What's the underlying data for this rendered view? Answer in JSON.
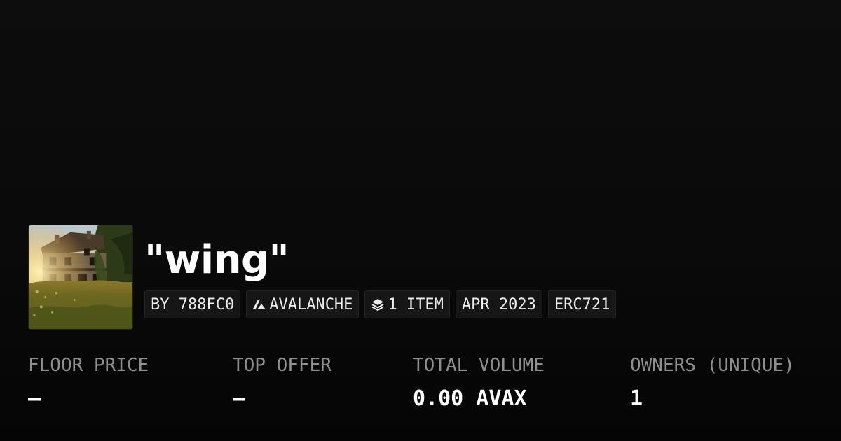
{
  "collection": {
    "title": "\"wing\"",
    "thumbnail_icon": "house-landscape-thumbnail"
  },
  "tags": [
    {
      "label": "BY 788FC0",
      "icon": ""
    },
    {
      "label": "AVALANCHE",
      "icon": "avalanche-icon"
    },
    {
      "label": "1 ITEM",
      "icon": "layers-icon"
    },
    {
      "label": "APR 2023",
      "icon": ""
    },
    {
      "label": "ERC721",
      "icon": ""
    }
  ],
  "stats": {
    "floor_price": {
      "label": "FLOOR PRICE",
      "value": "–"
    },
    "top_offer": {
      "label": "TOP OFFER",
      "value": "–"
    },
    "total_volume": {
      "label": "TOTAL VOLUME",
      "value": "0.00 AVAX"
    },
    "owners": {
      "label": "OWNERS (UNIQUE)",
      "value": "1"
    }
  },
  "colors": {
    "background": "#0a0a0a",
    "tag_background": "#161616",
    "label": "#8e8e8e",
    "value": "#ffffff"
  }
}
